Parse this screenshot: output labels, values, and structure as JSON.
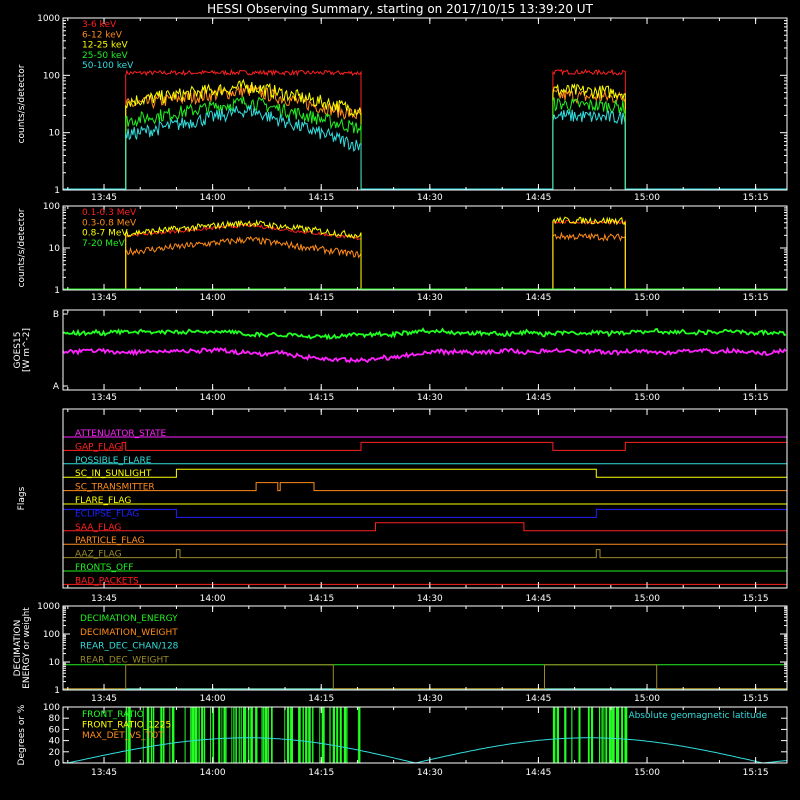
{
  "title": "HESSI Observing Summary, starting on 2017/10/15 13:39:20 UT",
  "time_axis": {
    "start": "13:39:20",
    "end": "15:19:20",
    "tick_labels": [
      "13:45",
      "14:00",
      "14:15",
      "14:30",
      "14:45",
      "15:00",
      "15:15"
    ]
  },
  "chart_data": [
    {
      "id": "xray-low",
      "type": "line",
      "ylabel": "counts/s/detector",
      "yscale": "log",
      "ylim": [
        1,
        1000
      ],
      "ytick_labels": [
        "1",
        "10",
        "100",
        "1000"
      ],
      "legend_position": "top-left",
      "observation_windows": [
        [
          "13:48:00",
          "14:20:30"
        ],
        [
          "14:47:00",
          "14:57:00"
        ]
      ],
      "series": [
        {
          "name": "3-6 keV",
          "color": "#ff2020",
          "values": [
            [
              "13:48",
              110
            ],
            [
              "14:05",
              112
            ],
            [
              "14:20",
              110
            ],
            [
              "14:47",
              115
            ],
            [
              "14:57",
              112
            ]
          ]
        },
        {
          "name": "6-12 keV",
          "color": "#ff8c1a",
          "values": [
            [
              "13:48",
              30
            ],
            [
              "14:05",
              55
            ],
            [
              "14:20",
              20
            ],
            [
              "14:47",
              45
            ],
            [
              "14:57",
              40
            ]
          ]
        },
        {
          "name": "12-25 keV",
          "color": "#ffff00",
          "values": [
            [
              "13:48",
              35
            ],
            [
              "14:05",
              65
            ],
            [
              "14:20",
              25
            ],
            [
              "14:47",
              55
            ],
            [
              "14:57",
              50
            ]
          ]
        },
        {
          "name": "25-50 keV",
          "color": "#22ee22",
          "values": [
            [
              "13:48",
              16
            ],
            [
              "14:05",
              35
            ],
            [
              "14:20",
              12
            ],
            [
              "14:47",
              32
            ],
            [
              "14:57",
              28
            ]
          ]
        },
        {
          "name": "50-100 keV",
          "color": "#33dddd",
          "values": [
            [
              "13:48",
              9
            ],
            [
              "14:05",
              25
            ],
            [
              "14:20",
              6
            ],
            [
              "14:47",
              20
            ],
            [
              "14:57",
              18
            ]
          ]
        }
      ]
    },
    {
      "id": "gamma",
      "type": "line",
      "ylabel": "counts/s/detector",
      "yscale": "log",
      "ylim": [
        1,
        100
      ],
      "ytick_labels": [
        "1",
        "10",
        "100"
      ],
      "legend_position": "top-left",
      "series": [
        {
          "name": "0.1-0.3 MeV",
          "color": "#ff2020",
          "values": [
            [
              "13:48",
              20
            ],
            [
              "14:05",
              35
            ],
            [
              "14:20",
              17
            ],
            [
              "14:47",
              42
            ],
            [
              "14:57",
              40
            ]
          ]
        },
        {
          "name": "0.3-0.8 MeV",
          "color": "#ff8c1a",
          "values": [
            [
              "13:48",
              8
            ],
            [
              "14:05",
              16
            ],
            [
              "14:20",
              7
            ],
            [
              "14:47",
              19
            ],
            [
              "14:57",
              18
            ]
          ]
        },
        {
          "name": "0.8-7 MeV",
          "color": "#ffff00",
          "values": [
            [
              "13:48",
              22
            ],
            [
              "14:05",
              40
            ],
            [
              "14:20",
              20
            ],
            [
              "14:47",
              46
            ],
            [
              "14:57",
              44
            ]
          ]
        },
        {
          "name": "7-20 MeV",
          "color": "#22ee22",
          "values": [
            [
              "13:39",
              1
            ],
            [
              "15:19",
              1
            ]
          ]
        }
      ]
    },
    {
      "id": "goes",
      "type": "line",
      "ylabel": "GOES15",
      "ylabel2": "[W m^-2]",
      "ytick_labels": [
        "A",
        "B"
      ],
      "series": [
        {
          "color": "#22ff22",
          "level": 0.72
        },
        {
          "color": "#ff22ff",
          "level": 0.48
        }
      ]
    },
    {
      "id": "flags",
      "type": "line",
      "ylabel": "Flags",
      "flags": [
        {
          "name": "ATTENUATOR_STATE",
          "color": "#ff22ff",
          "transitions": []
        },
        {
          "name": "GAP_FLAG",
          "color": "#ff2020",
          "transitions": [
            [
              "13:47:30",
              1
            ],
            [
              "13:48:00",
              0
            ],
            [
              "14:20:30",
              1
            ],
            [
              "14:47:00",
              0
            ],
            [
              "14:57:00",
              1
            ]
          ]
        },
        {
          "name": "POSSIBLE_FLARE",
          "color": "#33dddd",
          "transitions": []
        },
        {
          "name": "SC_IN_SUNLIGHT",
          "color": "#ffff00",
          "transitions": [
            [
              "13:55:00",
              1
            ],
            [
              "14:53:00",
              0
            ]
          ]
        },
        {
          "name": "SC_TRANSMITTER",
          "color": "#ff8c1a",
          "transitions": [
            [
              "14:06:00",
              1
            ],
            [
              "14:09:00",
              0
            ],
            [
              "14:09:20",
              1
            ],
            [
              "14:14:00",
              0
            ]
          ]
        },
        {
          "name": "FLARE_FLAG",
          "color": "#ffff00",
          "transitions": []
        },
        {
          "name": "ECLIPSE_FLAG",
          "color": "#2020ff",
          "transitions": [
            [
              "13:55:00",
              0
            ],
            [
              "14:53:00",
              1
            ]
          ]
        },
        {
          "name": "SAA_FLAG",
          "color": "#ff2020",
          "transitions": [
            [
              "14:22:30",
              1
            ],
            [
              "14:43:00",
              0
            ]
          ]
        },
        {
          "name": "PARTICLE_FLAG",
          "color": "#ff8c1a",
          "transitions": []
        },
        {
          "name": "AAZ_FLAG",
          "color": "#9a8a2a",
          "transitions": [
            [
              "13:55:00",
              1
            ],
            [
              "13:55:30",
              0
            ],
            [
              "14:53:00",
              1
            ],
            [
              "14:53:30",
              0
            ]
          ]
        },
        {
          "name": "FRONTS_OFF",
          "color": "#22ee22",
          "transitions": []
        },
        {
          "name": "BAD_PACKETS",
          "color": "#ff2020",
          "transitions": []
        }
      ]
    },
    {
      "id": "decimation",
      "type": "line",
      "ylabel": "DECIMATION",
      "ylabel2": "ENERGY or weight",
      "yscale": "log",
      "ylim": [
        1,
        1000
      ],
      "ytick_labels": [
        "1",
        "10",
        "100",
        "1000"
      ],
      "legend_position": "top-left",
      "series": [
        {
          "name": "DECIMATION_ENERGY",
          "color": "#22ee22",
          "values": [
            [
              "13:39",
              8
            ],
            [
              "15:19",
              8
            ]
          ]
        },
        {
          "name": "DECIMATION_WEIGHT",
          "color": "#ff8c1a",
          "values": [
            [
              "13:39",
              1.1
            ],
            [
              "15:19",
              1.1
            ]
          ]
        },
        {
          "name": "REAR_DEC_CHAN/128",
          "color": "#33dddd",
          "values": [
            [
              "13:39",
              1
            ],
            [
              "15:19",
              1
            ]
          ]
        },
        {
          "name": "REAR_DEC_WEIGHT",
          "color": "#9a8a2a",
          "transitions": [
            [
              "13:48:00",
              8
            ],
            [
              "14:16:40",
              1.1
            ],
            [
              "14:45:50",
              8
            ],
            [
              "15:01:20",
              1.1
            ]
          ]
        }
      ]
    },
    {
      "id": "ratio",
      "type": "line",
      "ylabel": "Degrees or %",
      "ylim": [
        0,
        100
      ],
      "ytick_labels": [
        "0",
        "20",
        "40",
        "60",
        "80",
        "100"
      ],
      "legend_position": "top-left",
      "legend_right": "Absolute geomagnetic latitude",
      "series": [
        {
          "name": "FRONT_RATIO",
          "color": "#22ff22"
        },
        {
          "name": "FRONT_RATIO_1225",
          "color": "#ffff00"
        },
        {
          "name": "MAX_DET_VS_TOT",
          "color": "#ff8c1a"
        },
        {
          "name": "Absolute geomagnetic latitude",
          "color": "#33dddd",
          "values": [
            [
              "13:40",
              0
            ],
            [
              "14:05",
              45
            ],
            [
              "14:28",
              0
            ],
            [
              "14:52",
              45
            ],
            [
              "15:16",
              0
            ]
          ]
        }
      ]
    }
  ]
}
